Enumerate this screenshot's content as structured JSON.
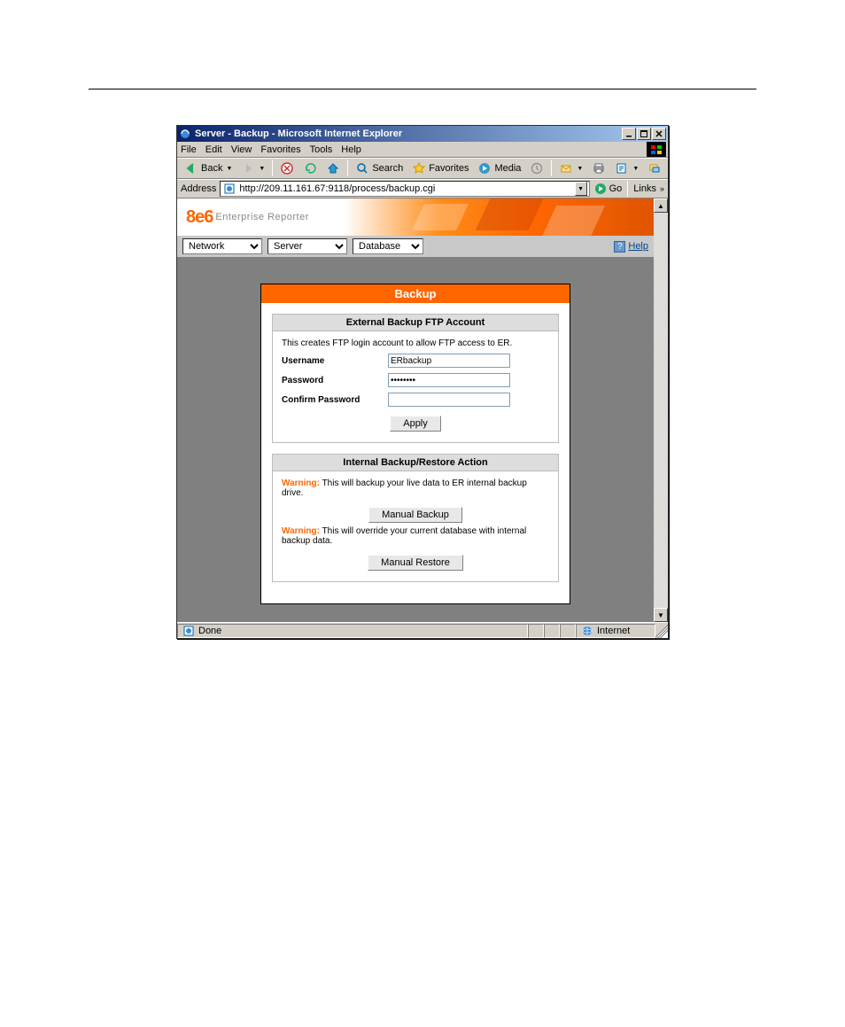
{
  "window": {
    "title": "Server - Backup - Microsoft Internet Explorer"
  },
  "menu": {
    "file": "File",
    "edit": "Edit",
    "view": "View",
    "favorites": "Favorites",
    "tools": "Tools",
    "help": "Help"
  },
  "toolbar": {
    "back": "Back",
    "search": "Search",
    "favorites": "Favorites",
    "media": "Media"
  },
  "address": {
    "label": "Address",
    "url": "http://209.11.161.67:9118/process/backup.cgi",
    "go": "Go",
    "links": "Links"
  },
  "banner": {
    "logo": "8e6",
    "sub": "Enterprise Reporter"
  },
  "nav": {
    "sel1": "Network",
    "sel2": "Server",
    "sel3": "Database",
    "help": "Help"
  },
  "panel": {
    "title": "Backup",
    "section1": {
      "header": "External Backup FTP Account",
      "desc": "This creates FTP login account to allow FTP access to ER.",
      "username_label": "Username",
      "username_value": "ERbackup",
      "password_label": "Password",
      "password_value": "********",
      "confirm_label": "Confirm Password",
      "confirm_value": "",
      "apply": "Apply"
    },
    "section2": {
      "header": "Internal Backup/Restore Action",
      "warn1_label": "Warning:",
      "warn1_text": " This will backup your live data to ER internal backup drive.",
      "btn1": "Manual Backup",
      "warn2_label": "Warning:",
      "warn2_text": " This will override your current database with internal backup data.",
      "btn2": "Manual Restore"
    }
  },
  "status": {
    "done": "Done",
    "zone": "Internet"
  }
}
